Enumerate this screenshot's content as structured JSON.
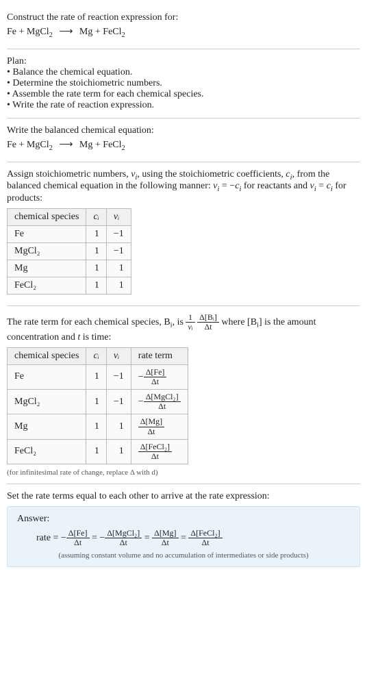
{
  "intro": {
    "title": "Construct the rate of reaction expression for:",
    "equation_lhs1": "Fe",
    "equation_lhs2": "MgCl",
    "equation_lhs2_sub": "2",
    "equation_rhs1": "Mg",
    "equation_rhs2": "FeCl",
    "equation_rhs2_sub": "2",
    "arrow": "⟶"
  },
  "plan": {
    "title": "Plan:",
    "b1": "• Balance the chemical equation.",
    "b2": "• Determine the stoichiometric numbers.",
    "b3": "• Assemble the rate term for each chemical species.",
    "b4": "• Write the rate of reaction expression."
  },
  "balanced": {
    "title": "Write the balanced chemical equation:"
  },
  "assign": {
    "title1": "Assign stoichiometric numbers, ",
    "nu": "ν",
    "i": "i",
    "title2": ", using the stoichiometric coefficients, ",
    "c": "c",
    "title3": ", from the balanced chemical equation in the following manner: ",
    "eq1a": "ν",
    "eq1b": " = −",
    "eq1c": "c",
    "eq1_tail": " for reactants and ",
    "eq2a": "ν",
    "eq2b": " = ",
    "eq2c": "c",
    "eq2_tail": " for products:"
  },
  "table1": {
    "h1": "chemical species",
    "h2": "cᵢ",
    "h3": "νᵢ",
    "r1c1": "Fe",
    "r1c2": "1",
    "r1c3": "−1",
    "r2c1": "MgCl₂",
    "r2c2": "1",
    "r2c3": "−1",
    "r3c1": "Mg",
    "r3c2": "1",
    "r3c3": "1",
    "r4c1": "FeCl₂",
    "r4c2": "1",
    "r4c3": "1"
  },
  "rateterm": {
    "pre": "The rate term for each chemical species, B",
    "i": "i",
    "mid": ", is ",
    "frac1num": "1",
    "frac1den": "νᵢ",
    "frac2num": "Δ[Bᵢ]",
    "frac2den": "Δt",
    "post1": " where [B",
    "post2": "] is the amount concentration and ",
    "tvar": "t",
    "post3": " is time:"
  },
  "table2": {
    "h1": "chemical species",
    "h2": "cᵢ",
    "h3": "νᵢ",
    "h4": "rate term",
    "r1c1": "Fe",
    "r1c2": "1",
    "r1c3": "−1",
    "r1num": "Δ[Fe]",
    "r1den": "Δt",
    "r1neg": "−",
    "r2c1": "MgCl₂",
    "r2c2": "1",
    "r2c3": "−1",
    "r2num": "Δ[MgCl₂]",
    "r2den": "Δt",
    "r2neg": "−",
    "r3c1": "Mg",
    "r3c2": "1",
    "r3c3": "1",
    "r3num": "Δ[Mg]",
    "r3den": "Δt",
    "r3neg": "",
    "r4c1": "FeCl₂",
    "r4c2": "1",
    "r4c3": "1",
    "r4num": "Δ[FeCl₂]",
    "r4den": "Δt",
    "r4neg": ""
  },
  "infnote": "(for infinitesimal rate of change, replace Δ with d)",
  "setequal": "Set the rate terms equal to each other to arrive at the rate expression:",
  "answer": {
    "label": "Answer:",
    "rate": "rate = ",
    "neg": "−",
    "eq": " = ",
    "f1num": "Δ[Fe]",
    "f1den": "Δt",
    "f2num": "Δ[MgCl₂]",
    "f2den": "Δt",
    "f3num": "Δ[Mg]",
    "f3den": "Δt",
    "f4num": "Δ[FeCl₂]",
    "f4den": "Δt",
    "note": "(assuming constant volume and no accumulation of intermediates or side products)"
  },
  "chart_data": {
    "type": "table",
    "title": "Stoichiometric numbers and rate terms",
    "tables": [
      {
        "columns": [
          "chemical species",
          "c_i",
          "ν_i"
        ],
        "rows": [
          [
            "Fe",
            1,
            -1
          ],
          [
            "MgCl2",
            1,
            -1
          ],
          [
            "Mg",
            1,
            1
          ],
          [
            "FeCl2",
            1,
            1
          ]
        ]
      },
      {
        "columns": [
          "chemical species",
          "c_i",
          "ν_i",
          "rate term"
        ],
        "rows": [
          [
            "Fe",
            1,
            -1,
            "-Δ[Fe]/Δt"
          ],
          [
            "MgCl2",
            1,
            -1,
            "-Δ[MgCl2]/Δt"
          ],
          [
            "Mg",
            1,
            1,
            "Δ[Mg]/Δt"
          ],
          [
            "FeCl2",
            1,
            1,
            "Δ[FeCl2]/Δt"
          ]
        ]
      }
    ],
    "rate_expression": "rate = -Δ[Fe]/Δt = -Δ[MgCl2]/Δt = Δ[Mg]/Δt = Δ[FeCl2]/Δt"
  }
}
